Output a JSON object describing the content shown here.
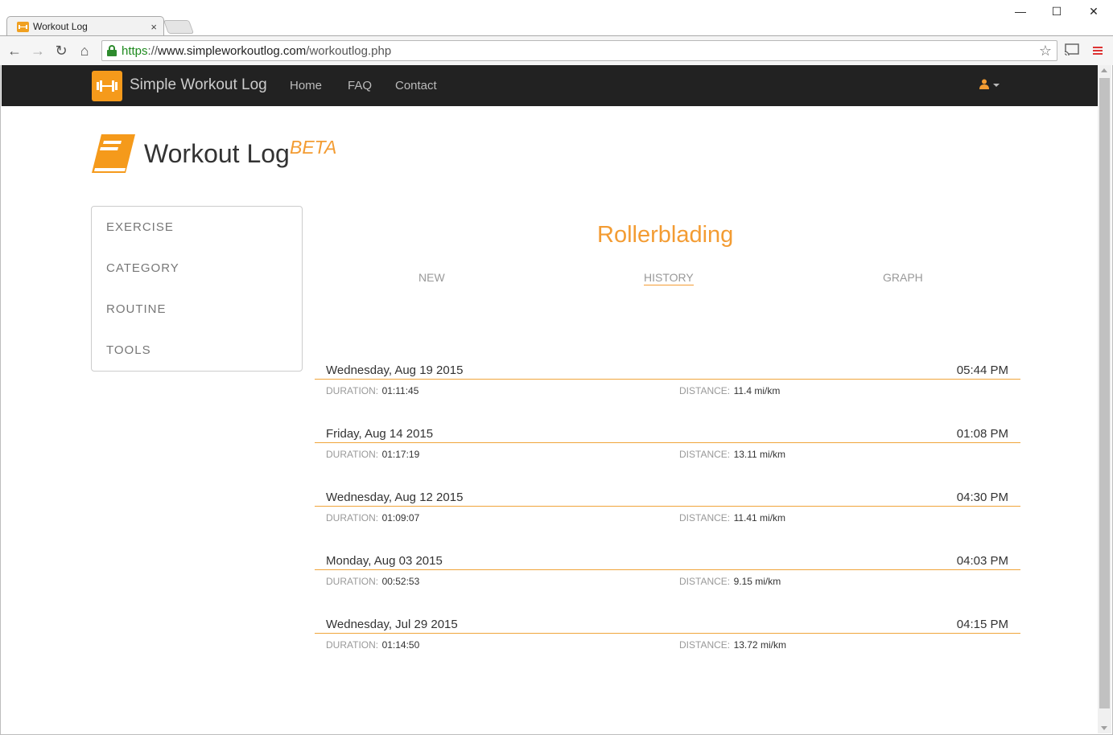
{
  "browser": {
    "tab_title": "Workout Log",
    "tab_close": "×",
    "url_scheme": "https",
    "url_sep": "://",
    "url_host": "www.simpleworkoutlog.com",
    "url_path": "/workoutlog.php",
    "win_min": "—",
    "win_max": "☐",
    "win_close": "✕"
  },
  "navbar": {
    "brand": "Simple Workout Log",
    "links": [
      "Home",
      "FAQ",
      "Contact"
    ]
  },
  "header": {
    "title": "Workout Log",
    "badge": "BETA"
  },
  "sidebar": {
    "items": [
      "EXERCISE",
      "CATEGORY",
      "ROUTINE",
      "TOOLS"
    ]
  },
  "main": {
    "exercise": "Rollerblading",
    "tabs": [
      "NEW",
      "HISTORY",
      "GRAPH"
    ],
    "active_tab": "HISTORY",
    "duration_label": "DURATION:",
    "distance_label": "DISTANCE:",
    "entries": [
      {
        "date": "Wednesday, Aug 19 2015",
        "time": "05:44 PM",
        "duration": "01:11:45",
        "distance": "11.4 mi/km"
      },
      {
        "date": "Friday, Aug 14 2015",
        "time": "01:08 PM",
        "duration": "01:17:19",
        "distance": "13.11 mi/km"
      },
      {
        "date": "Wednesday, Aug 12 2015",
        "time": "04:30 PM",
        "duration": "01:09:07",
        "distance": "11.41 mi/km"
      },
      {
        "date": "Monday, Aug 03 2015",
        "time": "04:03 PM",
        "duration": "00:52:53",
        "distance": "9.15 mi/km"
      },
      {
        "date": "Wednesday, Jul 29 2015",
        "time": "04:15 PM",
        "duration": "01:14:50",
        "distance": "13.72 mi/km"
      }
    ]
  },
  "colors": {
    "accent": "#f39c33",
    "navbar_bg": "#222222"
  }
}
